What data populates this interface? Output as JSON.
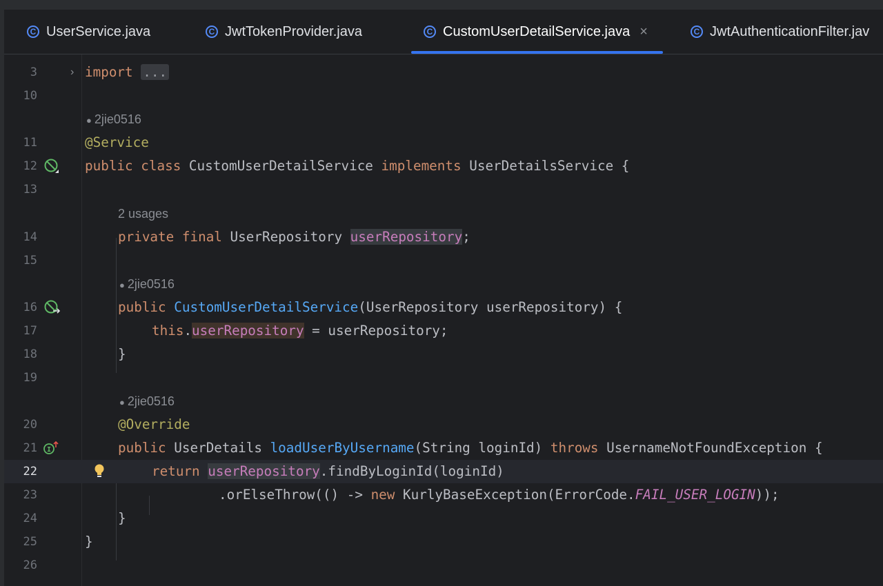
{
  "tabs": [
    {
      "label": "UserService.java",
      "active": false
    },
    {
      "label": "JwtTokenProvider.java",
      "active": false
    },
    {
      "label": "CustomUserDetailService.java",
      "active": true
    },
    {
      "label": "JwtAuthenticationFilter.jav",
      "active": false
    }
  ],
  "tab_close_glyph": "×",
  "fold_marker": "...",
  "lines": {
    "n3": "3",
    "n10": "10",
    "n11": "11",
    "n12": "12",
    "n13": "13",
    "n14": "14",
    "n15": "15",
    "n16": "16",
    "n17": "17",
    "n18": "18",
    "n19": "19",
    "n20": "20",
    "n21": "21",
    "n22": "22",
    "n23": "23",
    "n24": "24",
    "n25": "25",
    "n26": "26"
  },
  "inlays": {
    "author": "2jie0516",
    "usages": "2 usages"
  },
  "tokens": {
    "import": "import",
    "at_service": "@Service",
    "public": "public",
    "class": "class",
    "class_name": "CustomUserDetailService",
    "implements": "implements",
    "iface": "UserDetailsService {",
    "private": "private",
    "final": "final",
    "repo_type": "UserRepository",
    "repo_field": "userRepository",
    "semicolon": ";",
    "ctor_name": "CustomUserDetailService",
    "ctor_params": "(UserRepository userRepository) {",
    "this": "this",
    "dot": ".",
    "assign_rest": " = userRepository;",
    "close_brace": "}",
    "override": "@Override",
    "ret_type": "UserDetails",
    "method_name": "loadUserByUsername",
    "method_params": "(String loginId)",
    "throws": "throws",
    "exception": "UsernameNotFoundException {",
    "return": "return",
    "find_call": ".findByLoginId(loginId)",
    "or_else": ".orElseThrow(() -> ",
    "new": "new",
    "kurly": "KurlyBaseException(ErrorCode.",
    "fail_const": "FAIL_USER_LOGIN",
    "tail": "));"
  },
  "colors": {
    "keyword": "#cf8e6d",
    "annotation": "#b3ae60",
    "field": "#c77dbb",
    "function": "#56a8f5",
    "text": "#bcbec4",
    "accent": "#3574f0"
  },
  "icons": {
    "tab_file": "java-class-icon",
    "gutter_12": "bean-implemented-icon",
    "gutter_16": "bean-autowire-icon",
    "gutter_21": "implements-method-icon",
    "gutter_22": "lightbulb-icon"
  }
}
